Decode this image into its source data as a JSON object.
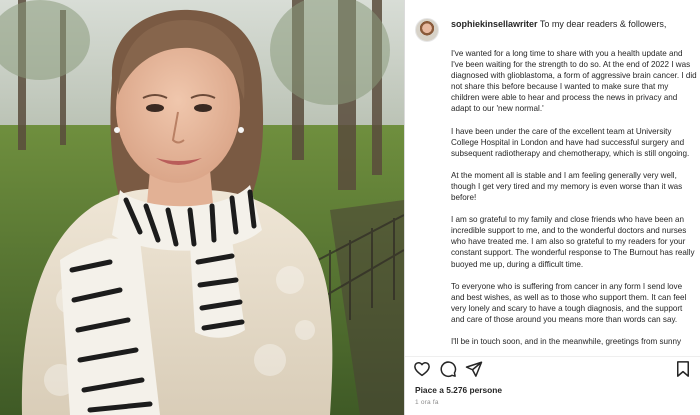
{
  "post": {
    "username": "sophiekinsellawriter",
    "caption_first_line": " To my dear readers & followers,",
    "caption_paragraphs": [
      "I've wanted for a long time to share with you a health update and I've been waiting for the strength to do so. At the end of 2022 I was diagnosed with glioblastoma, a form of aggressive brain cancer. I did not share this before because I wanted to make sure that my children were able to hear and process the news in privacy and adapt to our 'new normal.'",
      "I have been under the care of the excellent team at University College Hospital in London and have had successful surgery and subsequent radiotherapy and chemotherapy, which is still ongoing.",
      "At the moment all is stable and I am feeling generally very well, though I get very tired and my memory is even worse than it was before!",
      "I am so grateful to my family and close friends who have been an incredible support to me, and to the wonderful doctors and nurses who have treated me. I am also so grateful to my readers for your constant support. The wonderful response to The Burnout has really buoyed me up, during a difficult time.",
      "To everyone who is suffering from cancer in any form I send love and best wishes, as well as to those who support them. It can feel very lonely and scary to have a tough diagnosis, and the support and care of those around you means more than words can say.",
      "I'll be in touch soon, and in the meanwhile, greetings from sunny"
    ],
    "likes_text": "Piace a 5.276 persone",
    "time_text": "1 ora fa",
    "icons": {
      "avatar": "profile-avatar",
      "like": "heart-icon",
      "comment": "comment-icon",
      "share": "paper-plane-icon",
      "save": "bookmark-icon"
    },
    "colors": {
      "text": "#262626",
      "muted": "#8e8e8e",
      "divider": "#efefef"
    }
  }
}
